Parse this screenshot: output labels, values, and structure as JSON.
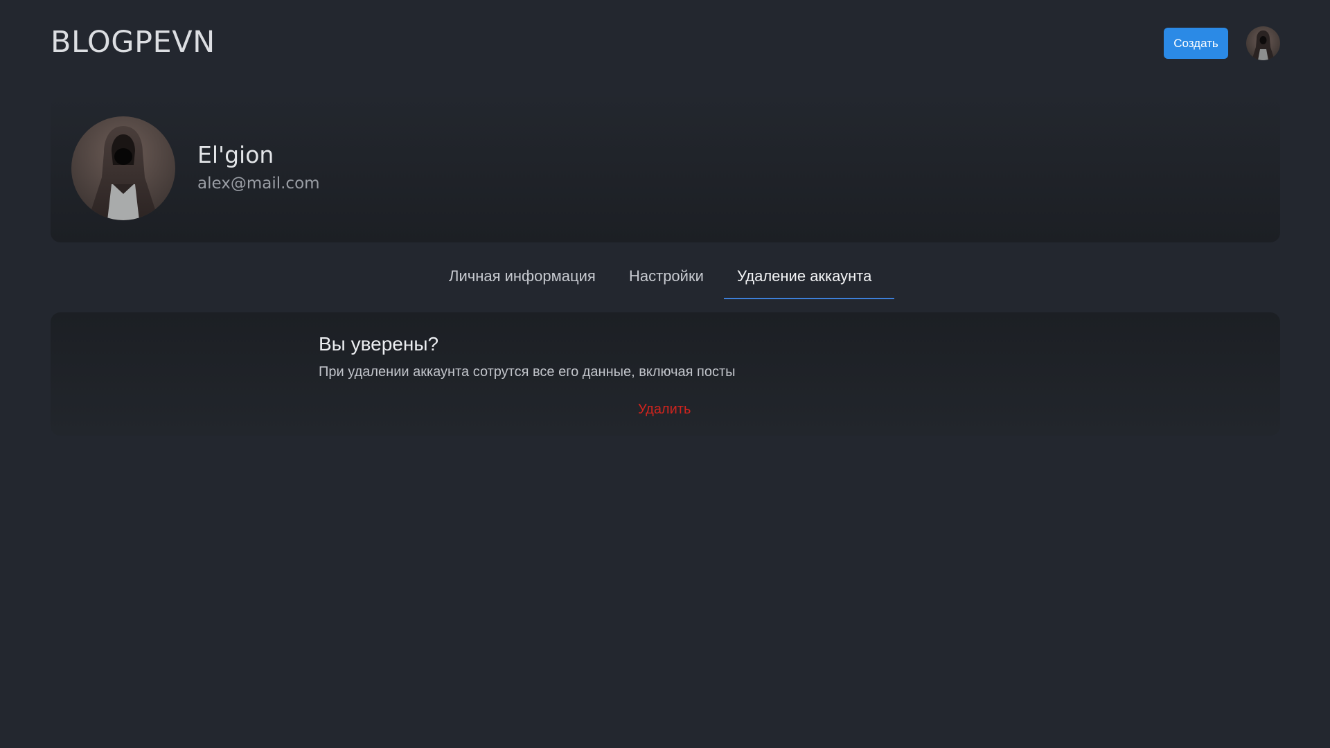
{
  "header": {
    "logo": "BLOGPEVN",
    "create_label": "Создать"
  },
  "profile": {
    "name": "El'gion",
    "email": "alex@mail.com"
  },
  "tabs": [
    {
      "label": "Личная информация",
      "active": false
    },
    {
      "label": "Настройки",
      "active": false
    },
    {
      "label": "Удаление аккаунта",
      "active": true
    }
  ],
  "delete_section": {
    "title": "Вы уверены?",
    "description": "При удалении аккаунта сотрутся все его данные, включая посты",
    "delete_label": "Удалить"
  },
  "colors": {
    "background": "#23272f",
    "accent": "#2b8ae6",
    "tab_underline": "#3d7fd9",
    "danger": "#d0241e"
  },
  "icons": {
    "header_avatar": "user-avatar-hooded-figure",
    "profile_avatar": "user-avatar-hooded-figure"
  }
}
